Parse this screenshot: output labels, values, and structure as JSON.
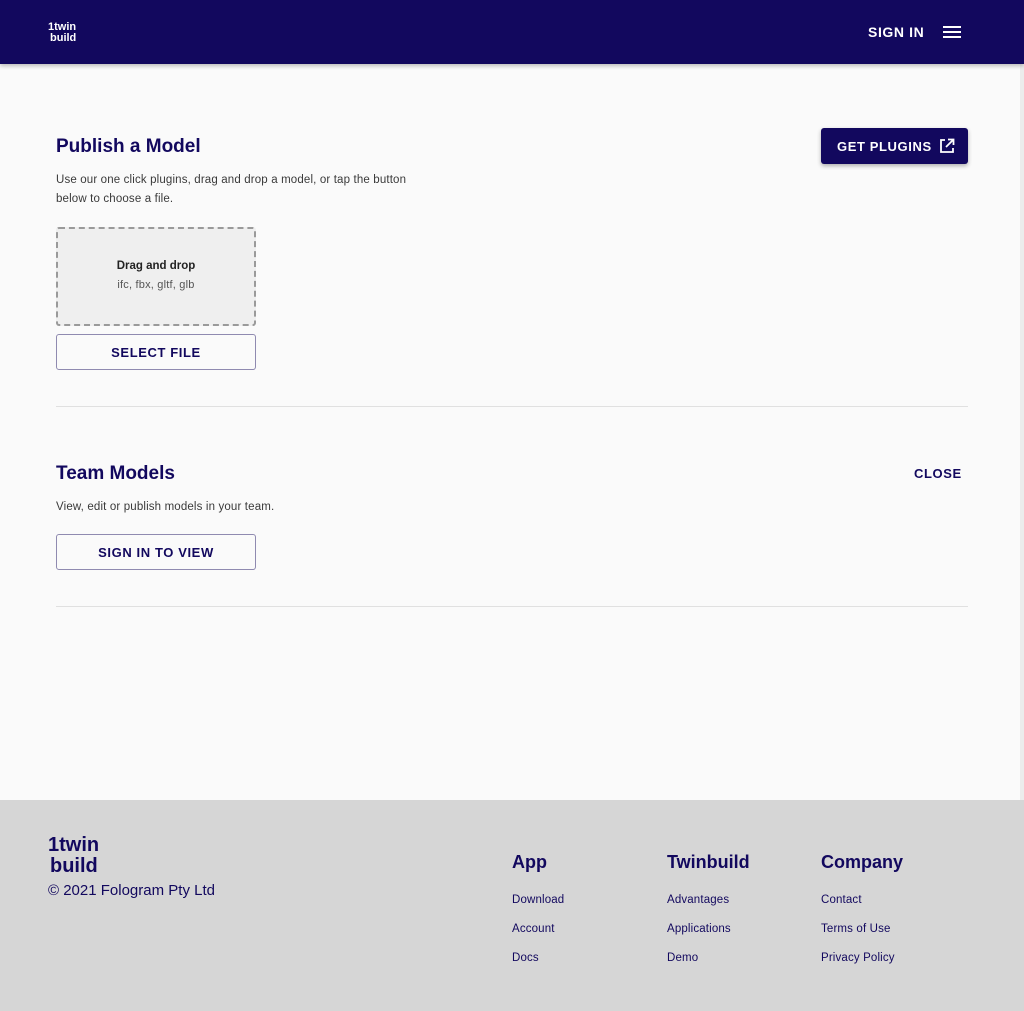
{
  "header": {
    "logo_text": "twin build",
    "signin_label": "SIGN IN"
  },
  "publish": {
    "title": "Publish a Model",
    "description_line1": "Use our one click plugins, drag and drop a model, or tap the button",
    "description_line2": "below to choose a file.",
    "get_plugins_label": "GET PLUGINS",
    "dropzone_title": "Drag and drop",
    "dropzone_formats": "ifc, fbx, gltf, glb",
    "select_file_label": "SELECT FILE"
  },
  "team": {
    "title": "Team Models",
    "description": "View, edit or publish models in your team.",
    "close_label": "CLOSE",
    "signin_view_label": "SIGN IN TO VIEW"
  },
  "footer": {
    "copyright": "© 2021 Fologram Pty Ltd",
    "columns": [
      {
        "title": "App",
        "links": [
          "Download",
          "Account",
          "Docs"
        ]
      },
      {
        "title": "Twinbuild",
        "links": [
          "Advantages",
          "Applications",
          "Demo"
        ]
      },
      {
        "title": "Company",
        "links": [
          "Contact",
          "Terms of Use",
          "Privacy Policy"
        ]
      }
    ]
  },
  "colors": {
    "brand": "#12085e",
    "background": "#fafafa",
    "footer_bg": "#d6d6d6"
  },
  "icons": [
    "twinbuild-logo",
    "menu-icon",
    "external-link-icon"
  ]
}
